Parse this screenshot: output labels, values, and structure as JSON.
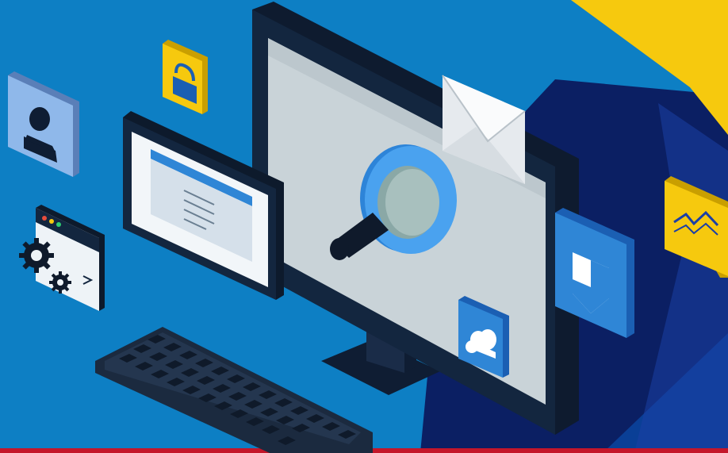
{
  "colors": {
    "bg_blue": "#0d7fc4",
    "mid_blue": "#0a5aa8",
    "deep_navy": "#0b1f63",
    "accent_yellow": "#f6c90e",
    "monitor_dark": "#13263f",
    "screen_gray": "#c9d3d8",
    "icon_blue": "#2f86d6",
    "icon_light_blue": "#8fb8ea",
    "bottom_red": "#c4162a"
  },
  "icons": [
    "user-icon",
    "lock-icon",
    "email-icon",
    "search-icon",
    "settings-gear-icon",
    "shield-icon",
    "cloud-icon",
    "chart-icon"
  ]
}
